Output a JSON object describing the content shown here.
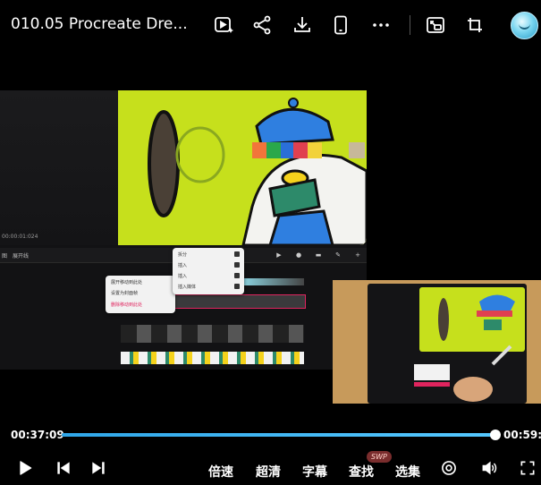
{
  "header": {
    "title": "010.05 Procreate Dre...",
    "icons": [
      "ai-video-icon",
      "share-icon",
      "download-icon",
      "phone-icon",
      "more-icon",
      "picture-in-picture-icon",
      "crop-icon",
      "avatar"
    ]
  },
  "video": {
    "timecode": "00:00:01:024",
    "toolbar_label_a": "图",
    "toolbar_label_b": "展开线",
    "context_menu_small": [
      {
        "label": "展开移动到此处"
      },
      {
        "label": "设置为封面帧"
      },
      {
        "label": "删除移动到此处"
      }
    ],
    "context_menu_large": [
      {
        "label": "拆分"
      },
      {
        "label": "插入"
      },
      {
        "label": "插入"
      },
      {
        "label": "插入媒体"
      }
    ]
  },
  "progress": {
    "current": "00:37:09",
    "total": "00:59:59",
    "fraction": 0.99
  },
  "controls": {
    "speed": "倍速",
    "quality": "超清",
    "subtitle": "字幕",
    "search": "查找",
    "search_badge": "SWP",
    "episodes": "选集"
  },
  "colors": {
    "accent": "#55c8ff",
    "art_green": "#c6e01c",
    "menu_red": "#e0245e"
  }
}
